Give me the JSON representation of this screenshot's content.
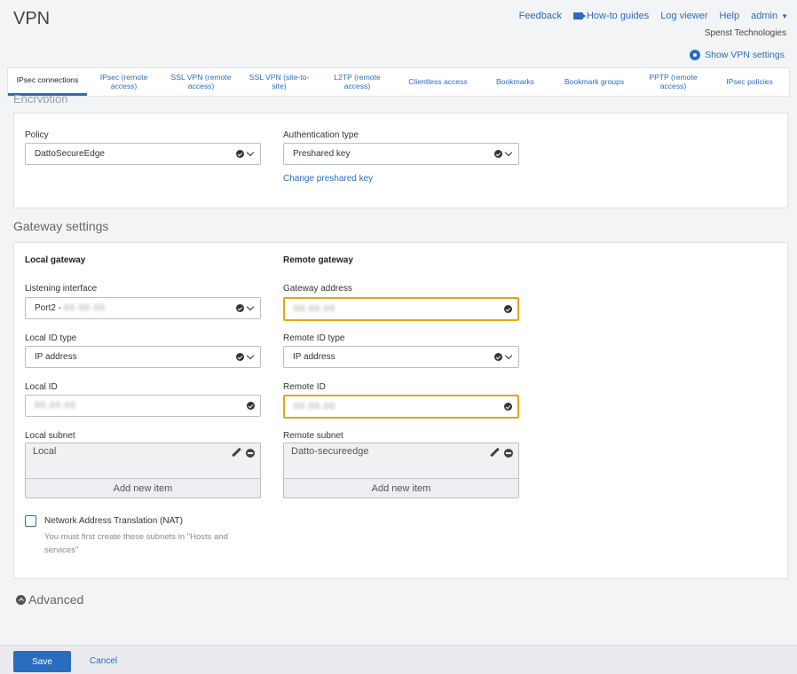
{
  "header": {
    "title": "VPN",
    "nav": {
      "feedback": "Feedback",
      "howto": "How-to guides",
      "log_viewer": "Log viewer",
      "help": "Help",
      "admin": "admin"
    },
    "company": "Spenst Technologies",
    "show_vpn_settings": "Show VPN settings"
  },
  "tabs": [
    {
      "label": "IPsec connections",
      "active": true
    },
    {
      "label": "IPsec (remote access)"
    },
    {
      "label": "SSL VPN (remote access)"
    },
    {
      "label": "SSL VPN (site-to-site)"
    },
    {
      "label": "L2TP (remote access)"
    },
    {
      "label": "Clientless access"
    },
    {
      "label": "Bookmarks"
    },
    {
      "label": "Bookmark groups"
    },
    {
      "label": "PPTP (remote access)"
    },
    {
      "label": "IPsec policies"
    }
  ],
  "encryption": {
    "heading_clipped": "Encryption",
    "policy_label": "Policy",
    "policy_value": "DattoSecureEdge",
    "auth_label": "Authentication type",
    "auth_value": "Preshared key",
    "change_key_link": "Change preshared key"
  },
  "gateway": {
    "section_title": "Gateway settings",
    "local": {
      "heading": "Local gateway",
      "listening_label": "Listening interface",
      "listening_value": "Port2 -",
      "listening_blurred": "00.00.00",
      "id_type_label": "Local ID type",
      "id_type_value": "IP address",
      "id_label": "Local ID",
      "id_blurred": "00.00.00",
      "subnet_label": "Local subnet",
      "subnet_item": "Local",
      "add_item": "Add new item"
    },
    "remote": {
      "heading": "Remote gateway",
      "address_label": "Gateway address",
      "address_blurred": "00.00.00",
      "id_type_label": "Remote ID type",
      "id_type_value": "IP address",
      "id_label": "Remote ID",
      "id_blurred": "00.00.00",
      "subnet_label": "Remote subnet",
      "subnet_item": "Datto-secureedge",
      "add_item": "Add new item"
    },
    "nat_label": "Network Address Translation (NAT)",
    "nat_hint": "You must first create these subnets in \"Hosts and services\""
  },
  "advanced_label": "Advanced",
  "footer": {
    "save": "Save",
    "cancel": "Cancel"
  },
  "colors": {
    "accent": "#2a6cc0",
    "highlight": "#e8a317"
  }
}
